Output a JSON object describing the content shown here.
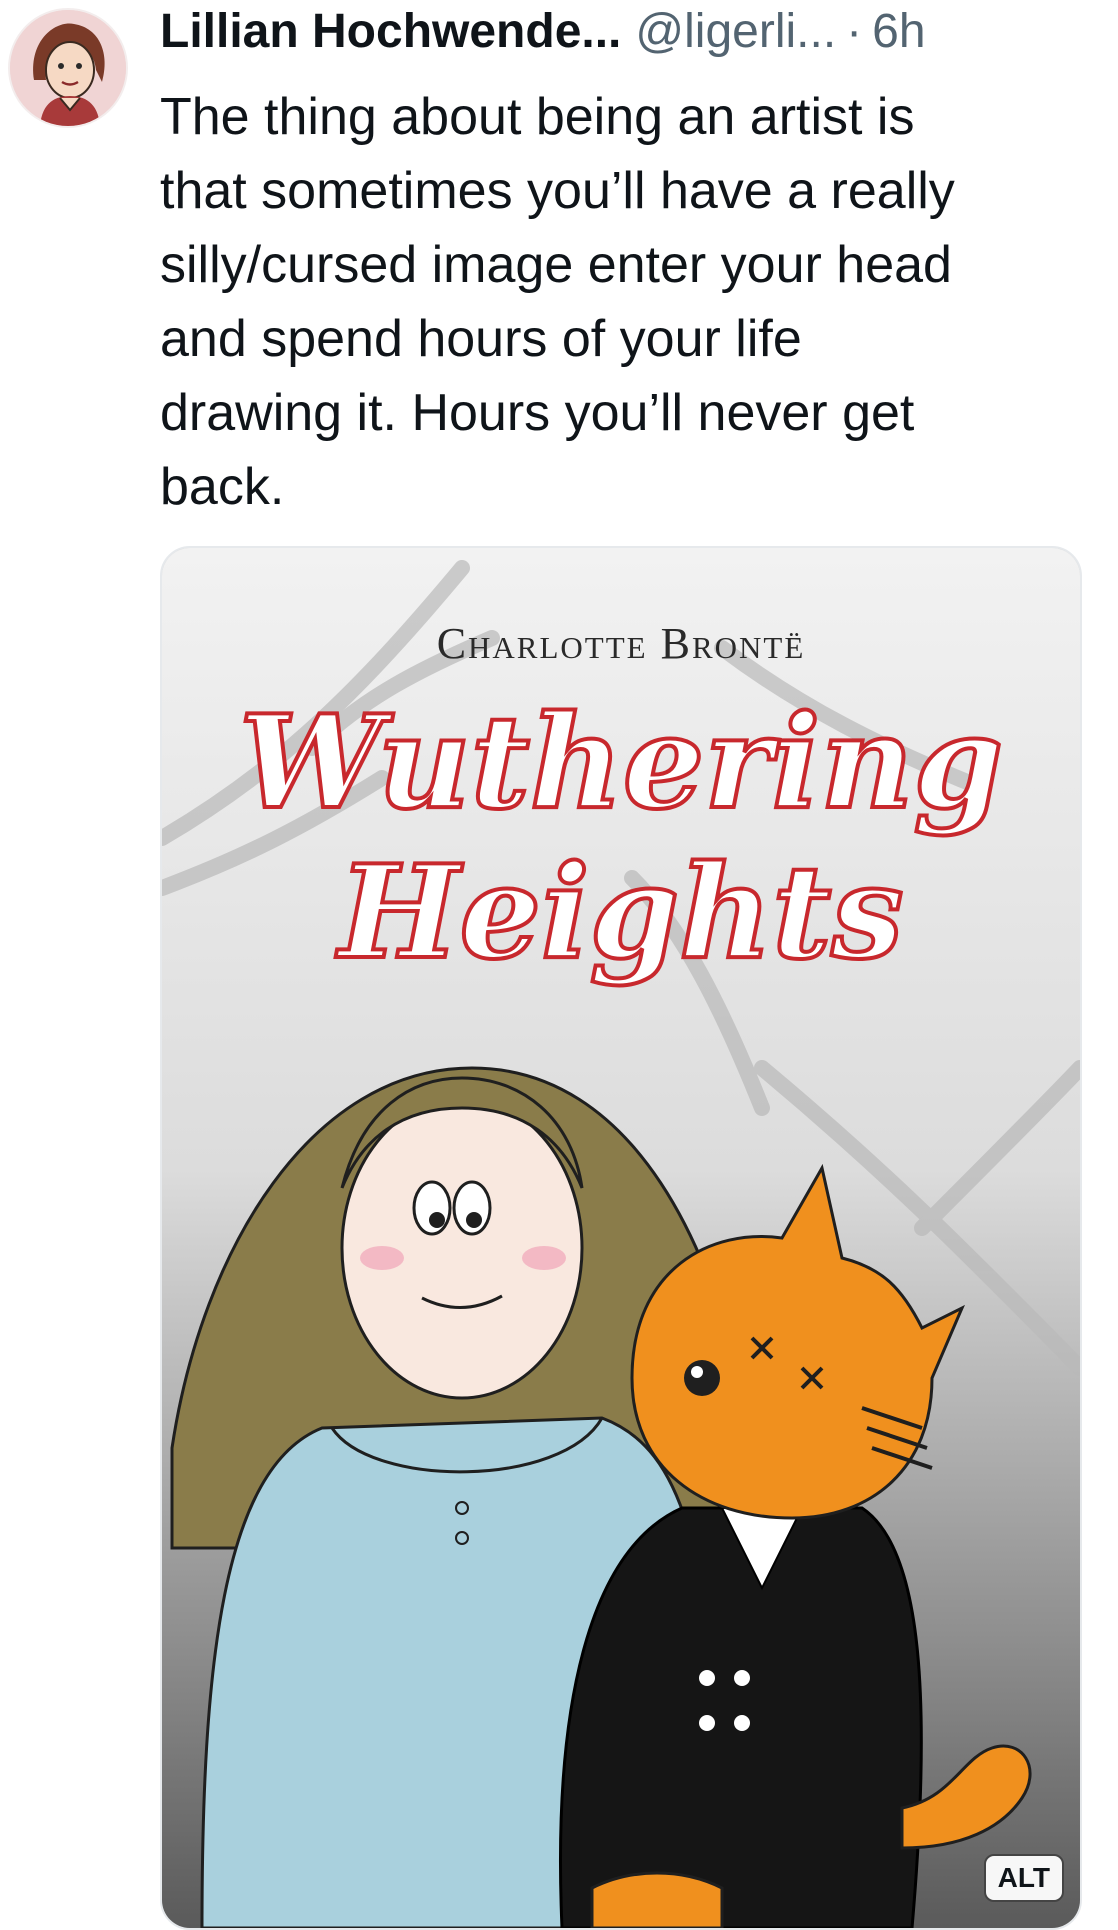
{
  "post": {
    "display_name": "Lillian Hochwende...",
    "handle": "@ligerli...",
    "separator": "·",
    "timestamp": "6h",
    "text": "The thing about being an artist is\nthat sometimes you’ll have a really\nsilly/cursed image enter your head\nand spend hours of your life\ndrawing it. Hours you’ll never get\nback.",
    "avatar_icon": "avatar-illustration"
  },
  "media": {
    "alt_label": "ALT",
    "cover_author": "Charlotte Brontë",
    "cover_title": "Wuthering\nHeights"
  },
  "colors": {
    "title_red": "#c8282d",
    "text_primary": "#0f1419",
    "text_secondary": "#536471",
    "cat_orange": "#f0901e",
    "dress_blue": "#a9d0dd",
    "hair_olive": "#8a7c4a"
  }
}
